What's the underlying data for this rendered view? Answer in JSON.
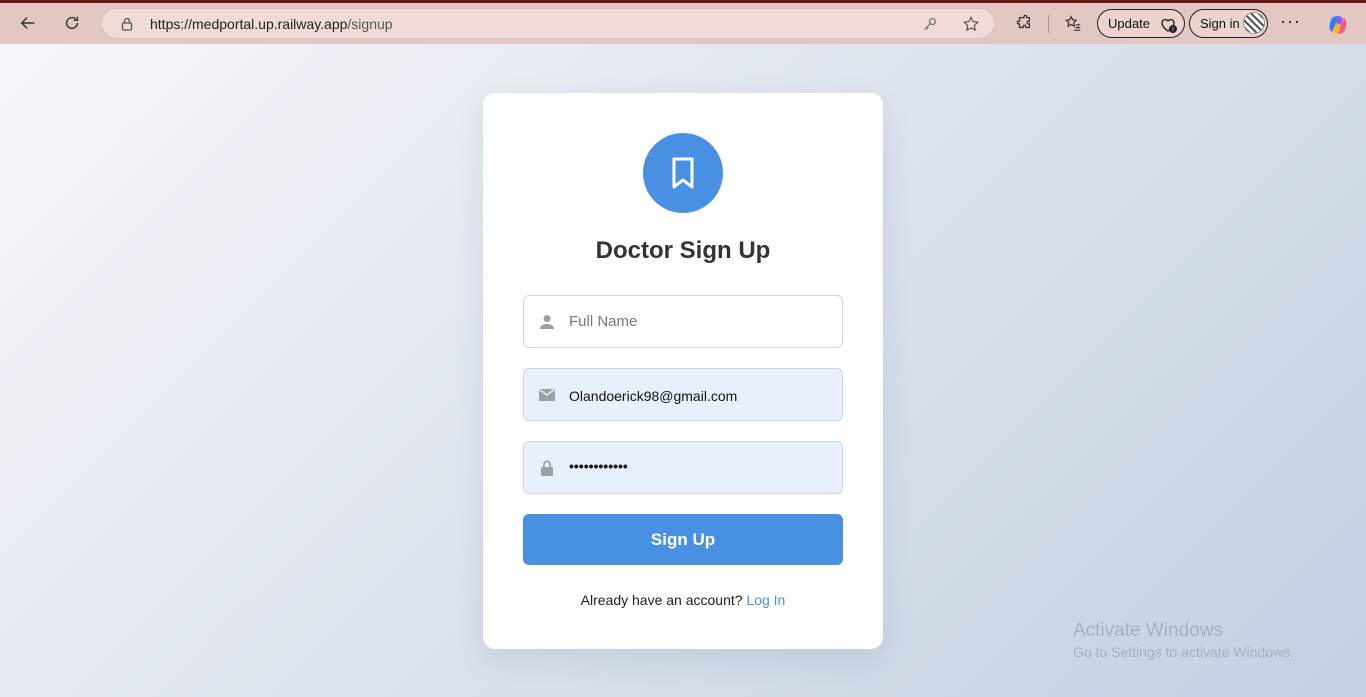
{
  "browser": {
    "url_host": "https://medportal.up.railway.app",
    "url_path": "/signup",
    "update_label": "Update",
    "signin_label": "Sign in",
    "more_label": "···"
  },
  "page": {
    "title": "Doctor Sign Up",
    "fields": {
      "full_name_placeholder": "Full Name",
      "email_value": "Olandoerick98@gmail.com",
      "password_masked": "••••••••••••"
    },
    "submit_label": "Sign Up",
    "footer_text": "Already have an account?",
    "login_link": "Log In"
  },
  "watermark": {
    "line1": "Activate Windows",
    "line2": "Go to Settings to activate Windows."
  },
  "colors": {
    "accent": "#4a90e2",
    "toolbar": "#e3c7c3"
  }
}
